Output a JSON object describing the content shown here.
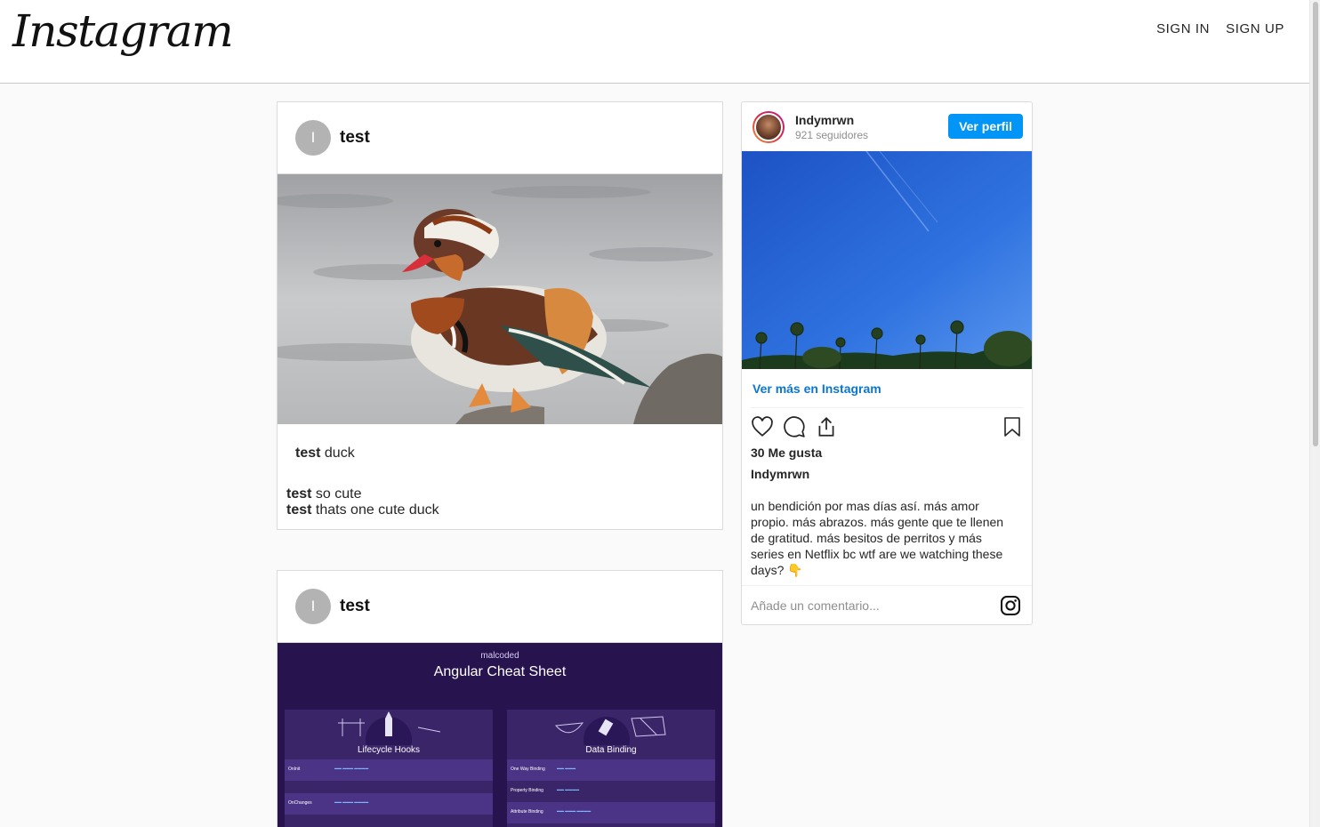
{
  "header": {
    "logo": "Instagram",
    "nav": {
      "sign_in": "SIGN IN",
      "sign_up": "SIGN UP"
    }
  },
  "posts": [
    {
      "avatar_initial": "I",
      "username": "test",
      "image_icon": "mandarin-duck-photo",
      "caption": {
        "user": "test",
        "text": "duck"
      },
      "comments": [
        {
          "user": "test",
          "text": "so cute"
        },
        {
          "user": "test",
          "text": "thats one cute duck"
        }
      ]
    },
    {
      "avatar_initial": "I",
      "username": "test",
      "image": {
        "brand": "malcoded",
        "title": "Angular Cheat Sheet",
        "left_heading": "Lifecycle Hooks",
        "right_heading": "Data Binding",
        "left_rows": [
          "OnInit",
          "OnChanges"
        ],
        "right_rows": [
          "One Way Binding",
          "Property Binding",
          "Attribute Binding"
        ]
      }
    }
  ],
  "embed": {
    "username": "Indymrwn",
    "followers": "921 seguidores",
    "view_profile": "Ver perfil",
    "view_more": "Ver más en Instagram",
    "likes": "30 Me gusta",
    "caption_user": "Indymrwn",
    "caption": "un bendición por mas días así. más amor propio. más abrazos. más gente que te llenen de gratitud. más besitos de perritos y más series en Netflix bc wtf are we watching these days? 👇",
    "comment_placeholder": "Añade un comentario...",
    "colors": {
      "button": "#0095f6",
      "link": "#0a75d2"
    }
  }
}
